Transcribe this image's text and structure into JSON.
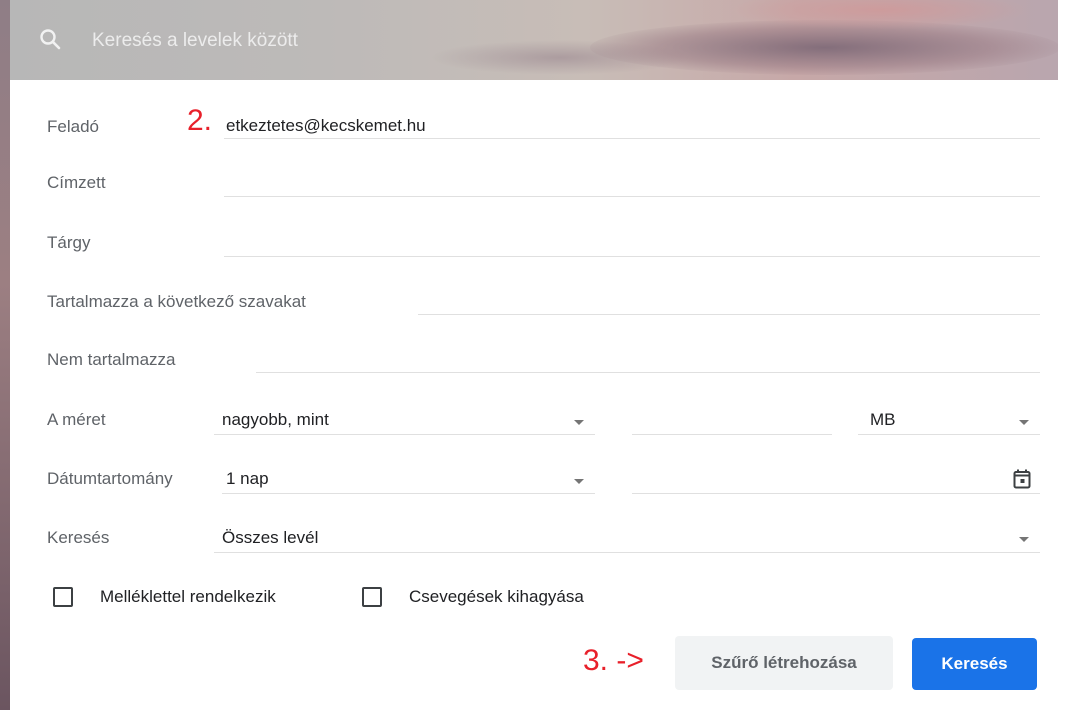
{
  "search": {
    "placeholder": "Keresés a levelek között"
  },
  "fields": {
    "from": {
      "label": "Feladó",
      "value": "etkeztetes@kecskemet.hu"
    },
    "to": {
      "label": "Címzett",
      "value": ""
    },
    "subject": {
      "label": "Tárgy",
      "value": ""
    },
    "has_words": {
      "label": "Tartalmazza a következő szavakat",
      "value": ""
    },
    "no_words": {
      "label": "Nem tartalmazza",
      "value": ""
    },
    "size": {
      "label": "A méret",
      "operator": "nagyobb, mint",
      "value": "",
      "unit": "MB"
    },
    "date_range": {
      "label": "Dátumtartomány",
      "range": "1 nap",
      "date": ""
    },
    "search_in": {
      "label": "Keresés",
      "value": "Összes levél"
    }
  },
  "checkboxes": {
    "has_attachment": {
      "label": "Melléklettel rendelkezik",
      "checked": false
    },
    "exclude_chats": {
      "label": "Csevegések kihagyása",
      "checked": false
    }
  },
  "buttons": {
    "create_filter": "Szűrő létrehozása",
    "search": "Keresés"
  },
  "annotations": {
    "step2": "2.",
    "step3": "3. ->",
    "color": "#e8202a"
  },
  "colors": {
    "primary": "#1a73e8",
    "label": "#5f6368"
  }
}
